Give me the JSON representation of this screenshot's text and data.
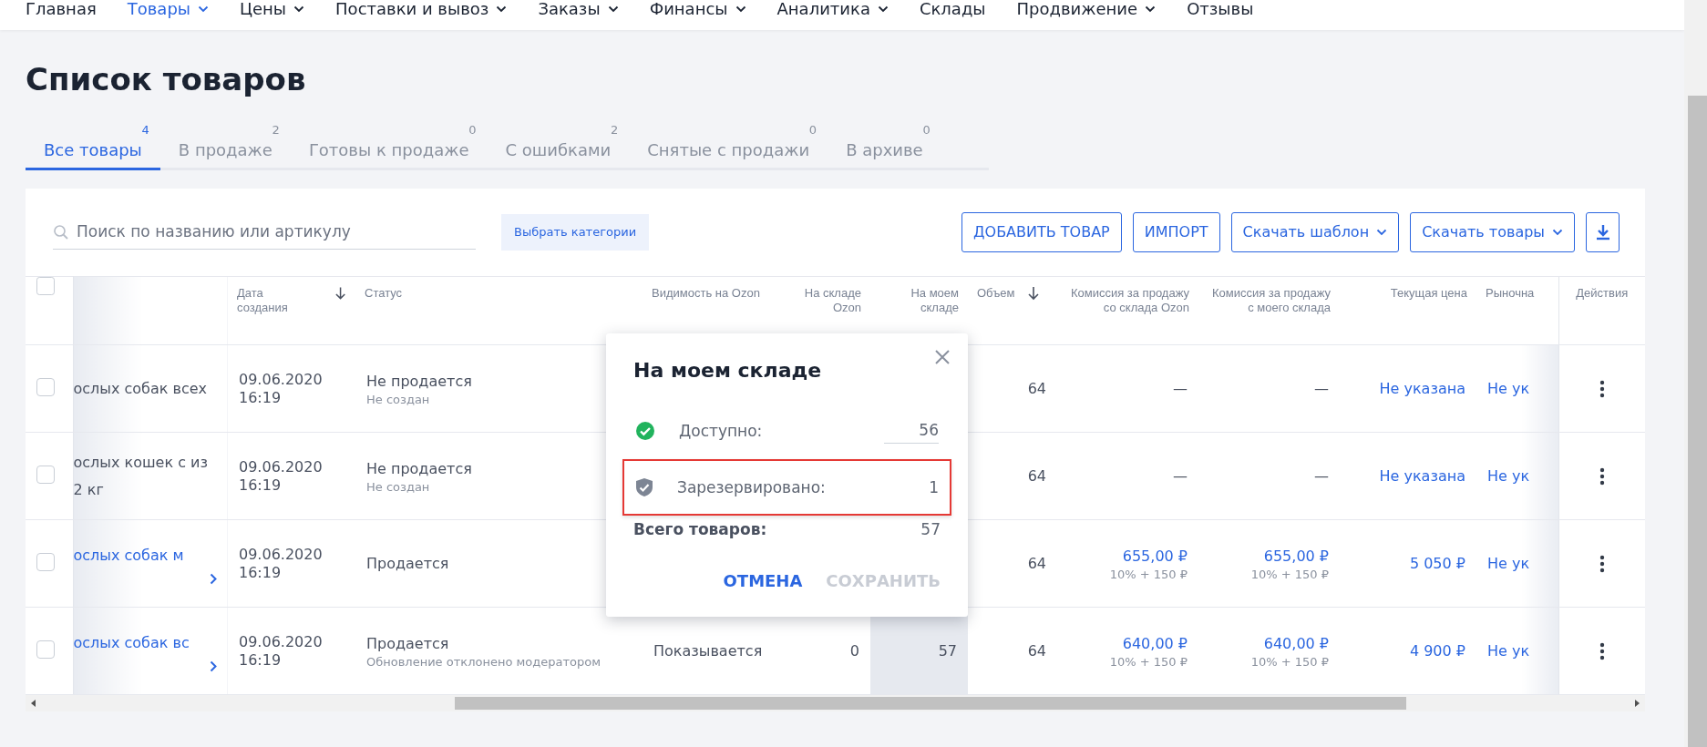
{
  "nav": [
    {
      "label": "Главная",
      "selected": false,
      "has_menu": false
    },
    {
      "label": "Товары",
      "selected": true,
      "has_menu": true
    },
    {
      "label": "Цены",
      "selected": false,
      "has_menu": true
    },
    {
      "label": "Поставки и вывоз",
      "selected": false,
      "has_menu": true
    },
    {
      "label": "Заказы",
      "selected": false,
      "has_menu": true
    },
    {
      "label": "Финансы",
      "selected": false,
      "has_menu": true
    },
    {
      "label": "Аналитика",
      "selected": false,
      "has_menu": true
    },
    {
      "label": "Склады",
      "selected": false,
      "has_menu": false
    },
    {
      "label": "Продвижение",
      "selected": false,
      "has_menu": true
    },
    {
      "label": "Отзывы",
      "selected": false,
      "has_menu": false
    }
  ],
  "page_title": "Список товаров",
  "tabs": [
    {
      "label": "Все товары",
      "count": "4",
      "selected": true
    },
    {
      "label": "В продаже",
      "count": "2",
      "selected": false
    },
    {
      "label": "Готовы к продаже",
      "count": "0",
      "selected": false
    },
    {
      "label": "С ошибками",
      "count": "2",
      "selected": false
    },
    {
      "label": "Снятые с продажи",
      "count": "0",
      "selected": false
    },
    {
      "label": "В архиве",
      "count": "0",
      "selected": false
    }
  ],
  "toolbar": {
    "search": {
      "placeholder": "Поиск по названию или артикулу"
    },
    "category_button": "Выбрать категории",
    "buttons": [
      {
        "kind": "outline",
        "label": "ДОБАВИТЬ ТОВАР"
      },
      {
        "kind": "outline",
        "label": "ИМПОРТ"
      },
      {
        "kind": "dropdown",
        "label": "Скачать шаблон"
      },
      {
        "kind": "dropdown",
        "label": "Скачать товары"
      },
      {
        "kind": "download"
      }
    ]
  },
  "table": {
    "header_checkbox": {
      "checked": false
    },
    "columns": [
      {
        "label": "Дата создания",
        "sorted": true
      },
      {
        "label": "Статус",
        "sorted": false
      },
      {
        "label": "Видимость на Ozon",
        "sorted": false
      },
      {
        "label": "На складе Ozon",
        "sorted": false
      },
      {
        "label": "На моем складе",
        "sorted": false
      },
      {
        "label": "Объем",
        "sorted": true
      },
      {
        "label": "Комиссия за продажу со склада Ozon",
        "sorted": false
      },
      {
        "label": "Комиссия за продажу с моего склада",
        "sorted": false
      },
      {
        "label": "Текущая цена",
        "sorted": false
      },
      {
        "label": "Рыночна",
        "sorted": false
      },
      {
        "label": "Действия",
        "sorted": false
      }
    ],
    "rows": [
      {
        "checked": false,
        "name": [
          "ослых собак всех"
        ],
        "linked": false,
        "expandable": false,
        "date": "09.06.2020",
        "time": "16:19",
        "status": "Не продается",
        "status_note": "Не создан",
        "volume": "64",
        "commission_ozon": {
          "value": "—"
        },
        "commission_mine": {
          "value": "—"
        },
        "price": "Не указана",
        "market": "Не ук"
      },
      {
        "checked": false,
        "name": [
          "ослых кошек с из",
          "2 кг"
        ],
        "linked": false,
        "expandable": false,
        "date": "09.06.2020",
        "time": "16:19",
        "status": "Не продается",
        "status_note": "Не создан",
        "volume": "64",
        "commission_ozon": {
          "value": "—"
        },
        "commission_mine": {
          "value": "—"
        },
        "price": "Не указана",
        "market": "Не ук"
      },
      {
        "checked": false,
        "name": [
          "ослых собак м"
        ],
        "linked": true,
        "expandable": true,
        "date": "09.06.2020",
        "time": "16:19",
        "status": "Продается",
        "volume": "64",
        "commission_ozon": {
          "value": "655,00 ₽",
          "note": "10% + 150 ₽"
        },
        "commission_mine": {
          "value": "655,00 ₽",
          "note": "10% + 150 ₽"
        },
        "price": "5 050 ₽",
        "market": "Не ук"
      },
      {
        "checked": false,
        "name": [
          "ослых собак вс"
        ],
        "linked": true,
        "expandable": true,
        "date": "09.06.2020",
        "time": "16:19",
        "status": "Продается",
        "status_note": "Обновление отклонено модератором",
        "visibility": "Показывается",
        "stock_ozon": "0",
        "stock_mine": "57",
        "volume": "64",
        "commission_ozon": {
          "value": "640,00 ₽",
          "note": "10% + 150 ₽"
        },
        "commission_mine": {
          "value": "640,00 ₽",
          "note": "10% + 150 ₽"
        },
        "price": "4 900 ₽",
        "market": "Не ук",
        "stock_active": true
      }
    ]
  },
  "popover": {
    "title": "На моем складе",
    "rows": [
      {
        "kind": "available",
        "label": "Доступно:",
        "value": "56",
        "editable": true,
        "highlighted": false
      },
      {
        "kind": "reserved",
        "label": "Зарезервировано:",
        "value": "1",
        "editable": false,
        "highlighted": true
      }
    ],
    "total": {
      "label": "Всего товаров:",
      "value": "57"
    },
    "buttons": [
      {
        "label": "ОТМЕНА",
        "disabled": false
      },
      {
        "label": "СОХРАНИТЬ",
        "disabled": true
      }
    ]
  }
}
